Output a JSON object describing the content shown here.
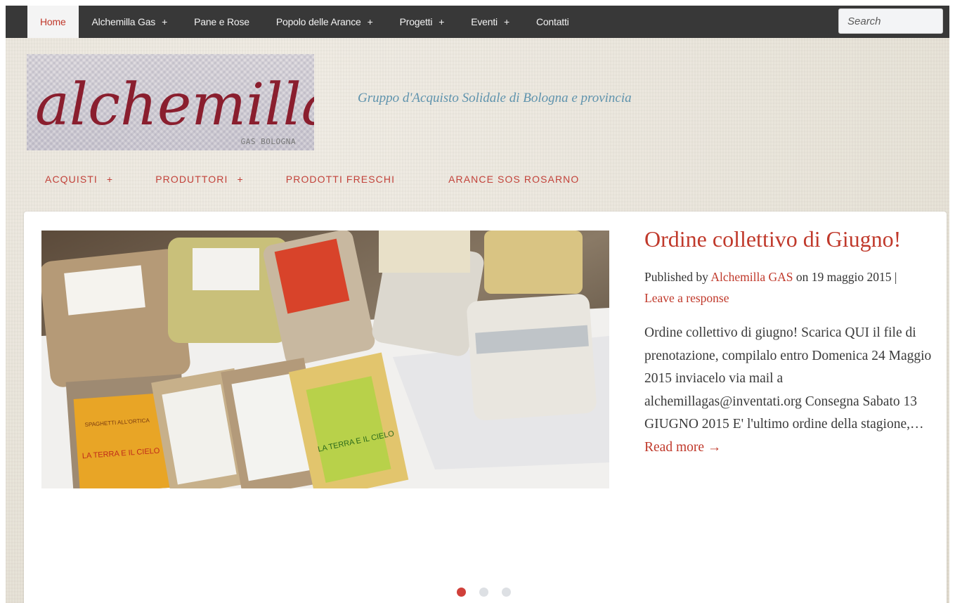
{
  "topnav": {
    "items": [
      {
        "label": "Home",
        "has_submenu": false,
        "active": true
      },
      {
        "label": "Alchemilla Gas",
        "has_submenu": true
      },
      {
        "label": "Pane e Rose",
        "has_submenu": false
      },
      {
        "label": "Popolo delle Arance",
        "has_submenu": true
      },
      {
        "label": "Progetti",
        "has_submenu": true
      },
      {
        "label": "Eventi",
        "has_submenu": true
      },
      {
        "label": "Contatti",
        "has_submenu": false
      }
    ],
    "plus": "+",
    "search_placeholder": "Search"
  },
  "header": {
    "logo_text": "alchemilla",
    "logo_subtext": "GAS BOLOGNA",
    "tagline": "Gruppo d'Acquisto Solidale di Bologna e provincia"
  },
  "subnav": {
    "items": [
      {
        "label": "ACQUISTI",
        "has_submenu": true
      },
      {
        "label": "PRODUTTORI",
        "has_submenu": true
      },
      {
        "label": "PRODOTTI FRESCHI",
        "has_submenu": false
      },
      {
        "label": "ARANCE SOS ROSARNO",
        "has_submenu": false
      }
    ]
  },
  "post": {
    "title": "Ordine collettivo di Giugno!",
    "meta_published_by": "Published by",
    "meta_author": "Alchemilla GAS",
    "meta_on": "on 19 maggio 2015 |",
    "meta_response": "Leave a response",
    "excerpt": "Ordine collettivo di giugno! Scarica QUI il file di prenotazione, compilalo entro Domenica 24 Maggio 2015 inviacelo via mail a alchemillagas@inventati.org Consegna Sabato 13 GIUGNO 2015 E' l'ultimo ordine della stagione,…",
    "read_more": "Read more →",
    "photo_labels": [
      "SPAGHETTI ALL'ORTICA",
      "LA TERRA E IL CIELO",
      "LA TERRA E IL CIELO"
    ]
  },
  "slider": {
    "slide_count": 3,
    "active_index": 0
  },
  "colors": {
    "accent": "#c0392b",
    "topbar": "#383838",
    "tagline": "#5f93ad"
  }
}
